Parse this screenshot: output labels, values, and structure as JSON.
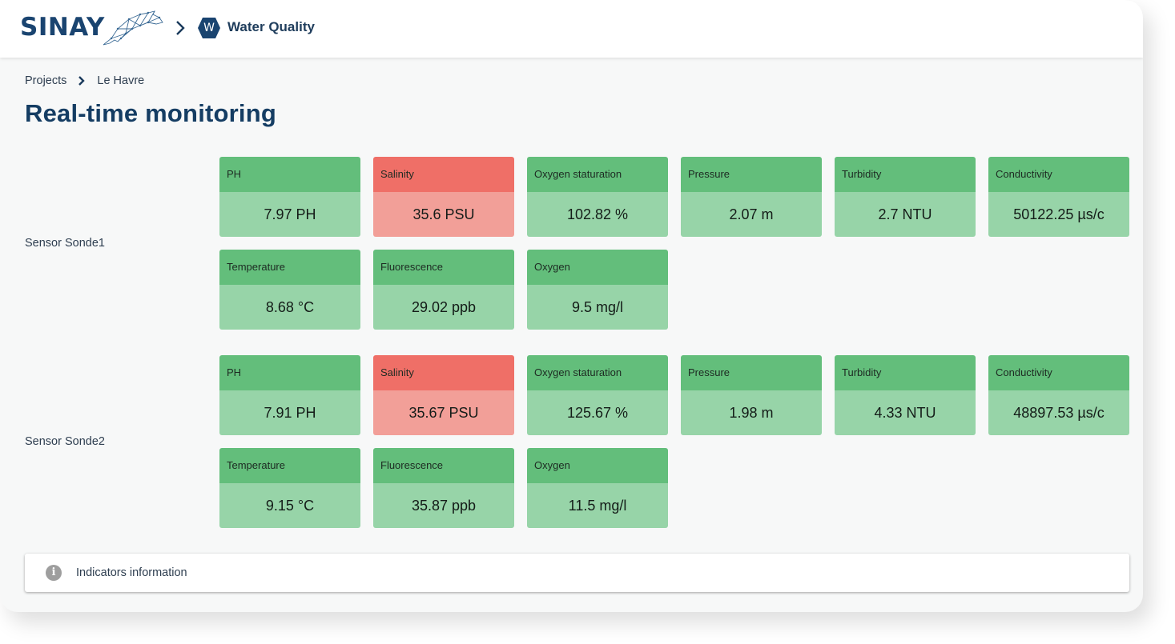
{
  "header": {
    "logo_text": "SINAY",
    "app_badge_letter": "W",
    "app_title": "Water Quality"
  },
  "breadcrumb": {
    "items": [
      "Projects",
      "Le Havre"
    ]
  },
  "page_title": "Real-time monitoring",
  "colors": {
    "brand": "#1a4470",
    "ok_header": "#63be7b",
    "ok_body": "#97d4a8",
    "alert_header": "#ef6f67",
    "alert_body": "#f29f98"
  },
  "sensors": [
    {
      "name": "Sensor Sonde1",
      "indicators": [
        {
          "label": "PH",
          "value": "7.97 PH",
          "status": "ok"
        },
        {
          "label": "Salinity",
          "value": "35.6 PSU",
          "status": "alert"
        },
        {
          "label": "Oxygen staturation",
          "value": "102.82 %",
          "status": "ok"
        },
        {
          "label": "Pressure",
          "value": "2.07 m",
          "status": "ok"
        },
        {
          "label": "Turbidity",
          "value": "2.7 NTU",
          "status": "ok"
        },
        {
          "label": "Conductivity",
          "value": "50122.25 µs/c",
          "status": "ok"
        },
        {
          "label": "Temperature",
          "value": "8.68 °C",
          "status": "ok"
        },
        {
          "label": "Fluorescence",
          "value": "29.02 ppb",
          "status": "ok"
        },
        {
          "label": "Oxygen",
          "value": "9.5 mg/l",
          "status": "ok"
        }
      ]
    },
    {
      "name": "Sensor Sonde2",
      "indicators": [
        {
          "label": "PH",
          "value": "7.91 PH",
          "status": "ok"
        },
        {
          "label": "Salinity",
          "value": "35.67 PSU",
          "status": "alert"
        },
        {
          "label": "Oxygen staturation",
          "value": "125.67 %",
          "status": "ok"
        },
        {
          "label": "Pressure",
          "value": "1.98 m",
          "status": "ok"
        },
        {
          "label": "Turbidity",
          "value": "4.33 NTU",
          "status": "ok"
        },
        {
          "label": "Conductivity",
          "value": "48897.53 µs/c",
          "status": "ok"
        },
        {
          "label": "Temperature",
          "value": "9.15 °C",
          "status": "ok"
        },
        {
          "label": "Fluorescence",
          "value": "35.87 ppb",
          "status": "ok"
        },
        {
          "label": "Oxygen",
          "value": "11.5 mg/l",
          "status": "ok"
        }
      ]
    }
  ],
  "info_bar": {
    "icon": "info-icon",
    "label": "Indicators information"
  }
}
